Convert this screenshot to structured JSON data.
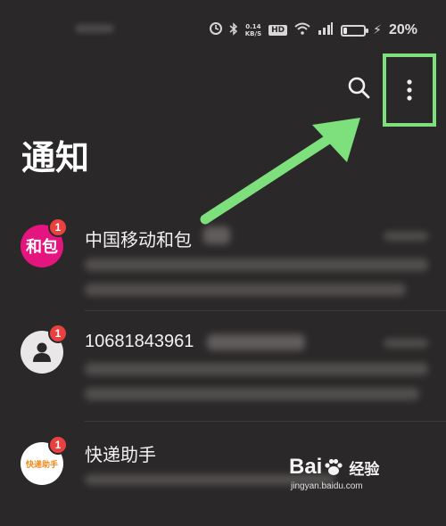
{
  "status_bar": {
    "net_speed_value": "0.14",
    "net_speed_unit": "KB/S",
    "hd_label": "HD",
    "battery_percent": "20%",
    "battery_level": 0.2,
    "icons": [
      "alarm-icon",
      "bluetooth-icon",
      "wifi-icon",
      "signal-icon",
      "battery-icon",
      "charging-icon"
    ]
  },
  "header": {
    "title": "通知",
    "search_icon": "search-icon",
    "more_icon": "more-vertical-icon"
  },
  "annotation": {
    "arrow_color": "#7ee07d",
    "highlight_color": "#7ee07d"
  },
  "messages": [
    {
      "avatar_text": "和包",
      "avatar_color": "#e4157f",
      "badge": "1",
      "sender": "中国移动和包",
      "preview_start": "[1 条]"
    },
    {
      "avatar_text": "",
      "avatar_color": "#e9e7e7",
      "badge": "1",
      "sender": "10681843961",
      "preview_start": "[1 条]"
    },
    {
      "avatar_text": "快递助手",
      "avatar_color": "#ffffff",
      "badge": "1",
      "sender": "快递助手",
      "preview_start": "[1 条]"
    }
  ],
  "watermark": {
    "logo_left": "Bai",
    "logo_right": "经验",
    "url": "jingyan.baidu.com"
  }
}
